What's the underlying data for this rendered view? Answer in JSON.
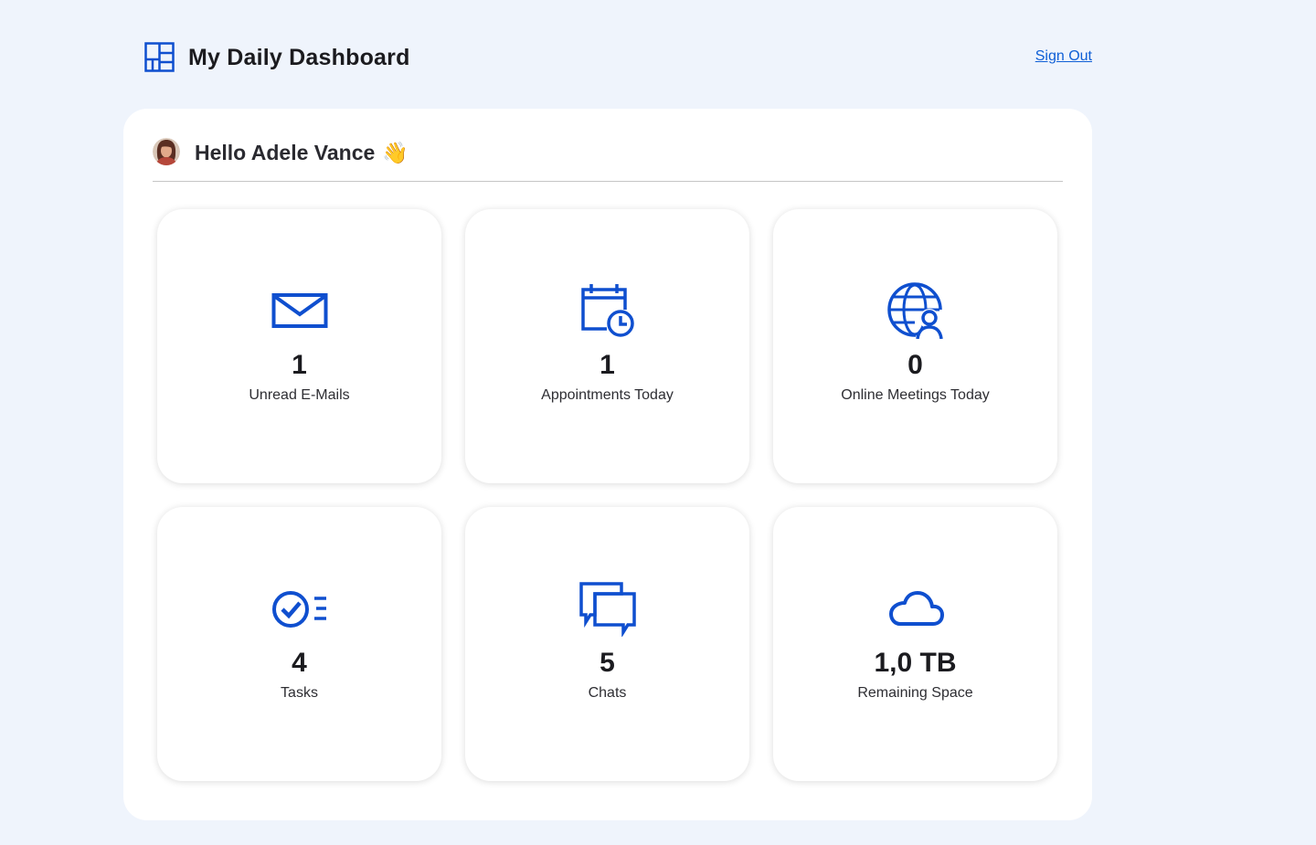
{
  "header": {
    "title": "My Daily Dashboard",
    "logo_icon": "dashboard-grid-icon",
    "sign_out_label": "Sign Out"
  },
  "greeting": {
    "text": "Hello Adele Vance",
    "emoji": "👋",
    "avatar_icon": "user-avatar"
  },
  "colors": {
    "background": "#eff4fc",
    "accent": "#0f4fcf",
    "link": "#0f5fd6",
    "card": "#ffffff"
  },
  "cards": [
    {
      "icon": "mail-icon",
      "value": "1",
      "label": "Unread E-Mails"
    },
    {
      "icon": "calendar-clock-icon",
      "value": "1",
      "label": "Appointments Today"
    },
    {
      "icon": "globe-person-icon",
      "value": "0",
      "label": "Online Meetings Today"
    },
    {
      "icon": "task-check-list-icon",
      "value": "4",
      "label": "Tasks"
    },
    {
      "icon": "chat-bubbles-icon",
      "value": "5",
      "label": "Chats"
    },
    {
      "icon": "cloud-icon",
      "value": "1,0 TB",
      "label": "Remaining Space"
    }
  ]
}
